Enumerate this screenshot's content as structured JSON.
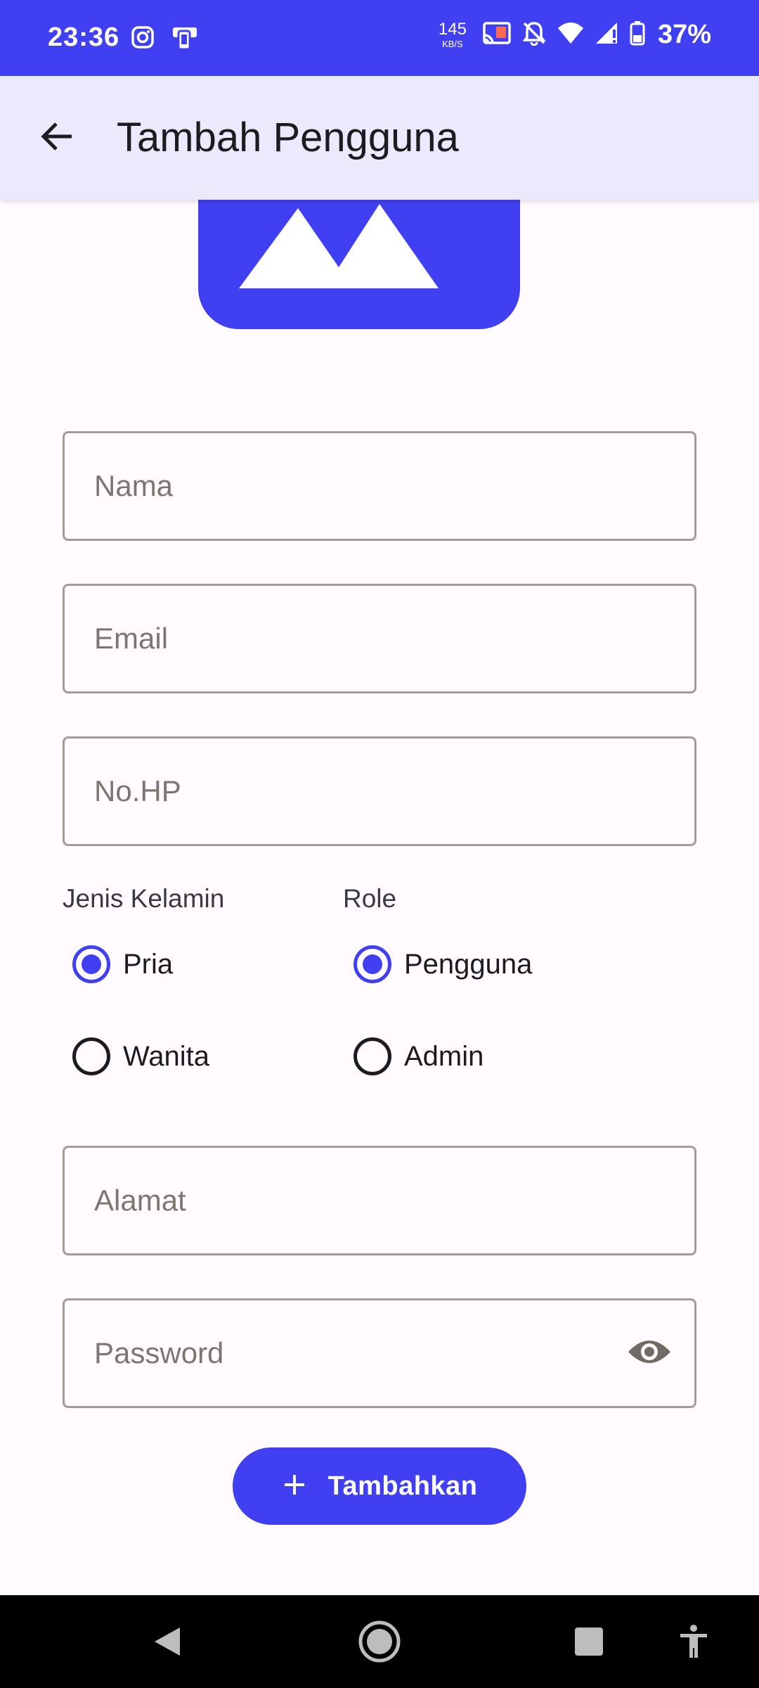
{
  "status_bar": {
    "time": "23:36",
    "net_speed_value": "145",
    "net_speed_unit": "KB/S",
    "battery": "37%"
  },
  "app_bar": {
    "title": "Tambah Pengguna"
  },
  "form": {
    "nama_placeholder": "Nama",
    "email_placeholder": "Email",
    "phone_placeholder": "No.HP",
    "alamat_placeholder": "Alamat",
    "password_placeholder": "Password",
    "gender": {
      "label": "Jenis Kelamin",
      "options": [
        "Pria",
        "Wanita"
      ],
      "selected": "Pria"
    },
    "role": {
      "label": "Role",
      "options": [
        "Pengguna",
        "Admin"
      ],
      "selected": "Pengguna"
    },
    "submit_label": "Tambahkan"
  },
  "colors": {
    "primary": "#4040f2",
    "app_bar_bg": "#ebe9fc",
    "background": "#fffbfe",
    "field_border": "#a09c96",
    "placeholder_text": "#7a7770"
  }
}
